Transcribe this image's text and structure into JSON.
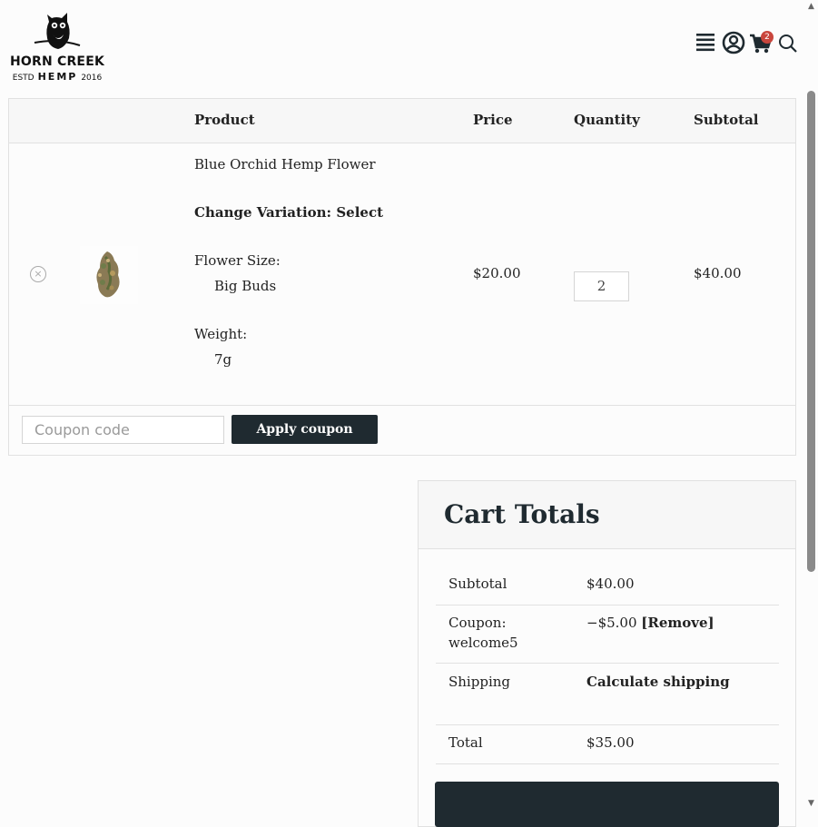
{
  "header": {
    "logo": {
      "line1": "HORN CREEK",
      "estd": "ESTD",
      "hemp": "HEMP",
      "year": "2016"
    },
    "menu_icon": "menu-icon",
    "account_icon": "account-icon",
    "cart_icon": "cart-icon",
    "cart_count": "2",
    "search_icon": "search-icon"
  },
  "cart_table": {
    "headers": {
      "product": "Product",
      "price": "Price",
      "quantity": "Quantity",
      "subtotal": "Subtotal"
    },
    "item": {
      "name": "Blue Orchid Hemp Flower",
      "change_variation": "Change Variation: Select",
      "flower_size_label": "Flower Size:",
      "flower_size_value": "Big Buds",
      "weight_label": "Weight:",
      "weight_value": "7g",
      "price": "$20.00",
      "quantity": "2",
      "subtotal": "$40.00"
    },
    "coupon_placeholder": "Coupon code",
    "apply_coupon": "Apply coupon"
  },
  "totals": {
    "title": "Cart Totals",
    "subtotal_label": "Subtotal",
    "subtotal_value": "$40.00",
    "coupon_label": "Coupon:",
    "coupon_code": "welcome5",
    "coupon_value": "−$5.00",
    "coupon_remove": "[Remove]",
    "shipping_label": "Shipping",
    "shipping_value": "Calculate shipping",
    "total_label": "Total",
    "total_value": "$35.00"
  },
  "colors": {
    "accent": "#1f2a30",
    "badge": "#c9463d",
    "border": "#e1e1e1"
  }
}
